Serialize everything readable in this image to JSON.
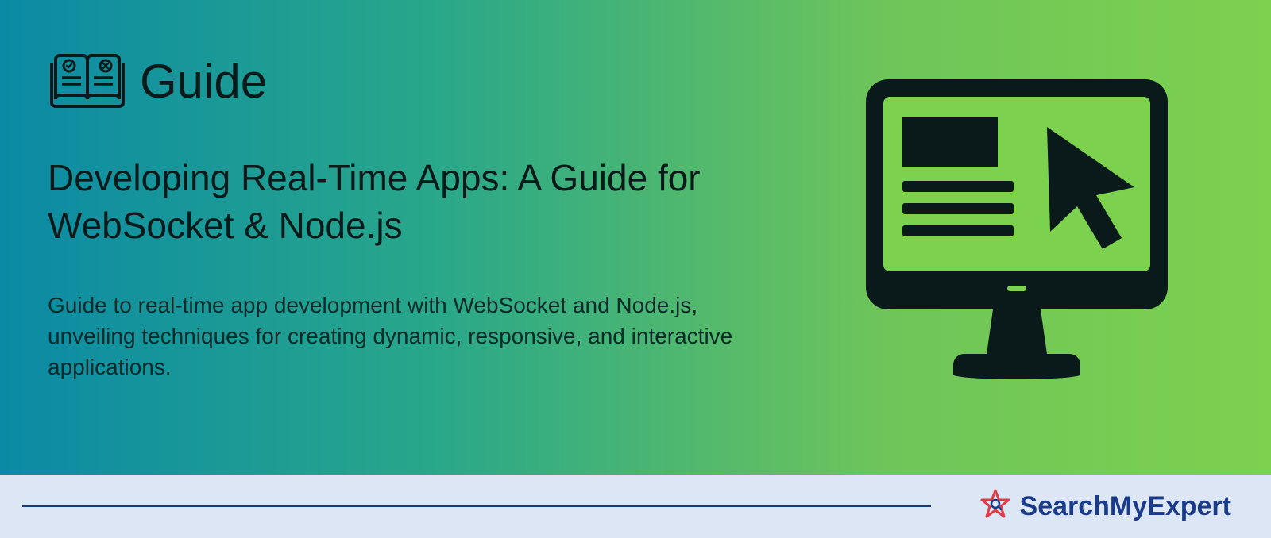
{
  "header": {
    "category_label": "Guide"
  },
  "title": "Developing Real-Time Apps: A Guide for WebSocket & Node.js",
  "description": "Guide to real-time app development with WebSocket and Node.js, unveiling techniques for creating dynamic, responsive, and interactive applications.",
  "footer": {
    "brand_name": "SearchMyExpert"
  }
}
